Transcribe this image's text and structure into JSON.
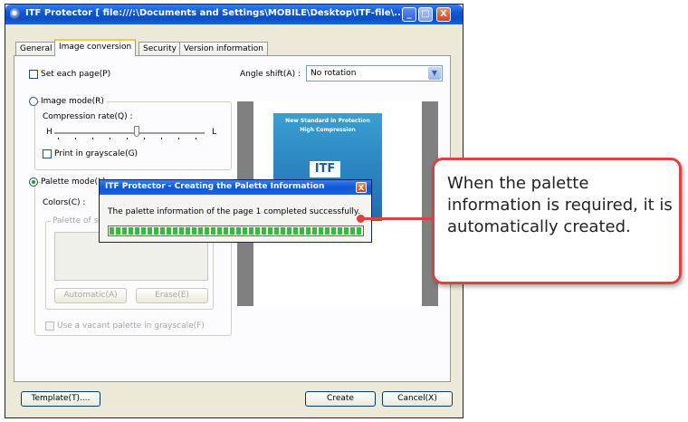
{
  "window": {
    "title": "ITF Protector [ file:///:\\Documents and Settings\\MOBILE\\Desktop\\ITF-file\\...",
    "controls": {
      "minimize": "_",
      "maximize": "□",
      "close": "X"
    }
  },
  "tabs": [
    {
      "label": "General",
      "active": false
    },
    {
      "label": "Image conversion",
      "active": true
    },
    {
      "label": "Security",
      "active": false
    },
    {
      "label": "Version information",
      "active": false
    }
  ],
  "options": {
    "set_each_page": "Set each page(P)",
    "angle_label": "Angle shift(A) :",
    "angle_value": "No rotation"
  },
  "image_mode": {
    "label": "Image mode(R)",
    "compression_label": "Compression rate(Q) :",
    "low": "H",
    "high": "L",
    "compression_level": 0.55,
    "grayscale": "Print in grayscale(G)"
  },
  "palette_mode": {
    "label": "Palette mode(L)",
    "colors_label": "Colors(C) :",
    "palette_group": "Palette of sp",
    "automatic": "Automatic(A)",
    "erase": "Erase(E)",
    "vacant": "Use a vacant palette in grayscale(F)"
  },
  "preview": {
    "heading1": "New Standard in Protection",
    "heading2": "High Compression",
    "logo": "ITF"
  },
  "footer": {
    "template": "Template(T)....",
    "create": "Create",
    "cancel": "Cancel(X)"
  },
  "dialog": {
    "title": "ITF Protector - Creating the Palette Information",
    "message": "The palette information of the page 1 completed successfully.",
    "progress": 1.0,
    "close": "X"
  },
  "callout": {
    "text": "When the palette information is required, it is automatically created."
  },
  "colors": {
    "accent": "#e04040",
    "titlebar": "#0c58d6",
    "progress": "#2fbf2f"
  }
}
